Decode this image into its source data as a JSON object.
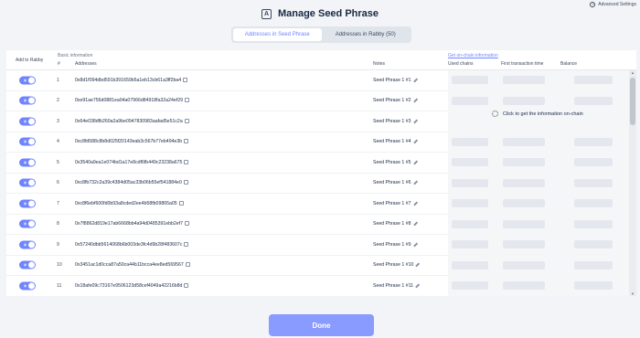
{
  "header": {
    "title": "Manage Seed Phrase",
    "title_icon": "seed-phrase-icon",
    "advanced_settings": "Advanced Settings"
  },
  "tabs": [
    {
      "label": "Addresses in Seed Phrase",
      "active": true
    },
    {
      "label": "Addresses in Rabby (50)",
      "active": false
    }
  ],
  "table": {
    "group_basic": "Basic information",
    "group_onchain": "Get on-chain information",
    "columns": {
      "add_to_rabby": "Add to Rabby",
      "index": "#",
      "addresses": "Addresses",
      "notes": "Notes",
      "used_chains": "Used chains",
      "first_tx": "First transaction time",
      "balance": "Balance"
    },
    "onchain_prompt": "Click to get the information on-chain",
    "rows": [
      {
        "index": "1",
        "address": "0x8d1f094dbd591b391659b5a1eb13cb61a3ff2ba4",
        "note": "Seed Phrase 1 #1",
        "enabled": true
      },
      {
        "index": "2",
        "address": "0xe91ae756d0881ea04a07966d84918fa32a24ef29",
        "note": "Seed Phrase 1 #2",
        "enabled": true
      },
      {
        "index": "3",
        "address": "0x64e038dfb260a2a9be0947830983aafad5e51c2a",
        "note": "Seed Phrase 1 #3",
        "enabled": true
      },
      {
        "index": "4",
        "address": "0xc8fd588c8b8d025f20143eab3c567b77eb494e3b",
        "note": "Seed Phrase 1 #4",
        "enabled": true
      },
      {
        "index": "5",
        "address": "0x3540a9ea1e074bd1a17e8cdf6fb449c23238a675",
        "note": "Seed Phrase 1 #5",
        "enabled": true
      },
      {
        "index": "6",
        "address": "0xc8fb732c2a39c4384d05ac33b06b55ef541884e0",
        "note": "Seed Phrase 1 #6",
        "enabled": true
      },
      {
        "index": "7",
        "address": "0xc8f6ebf600fd0b93a8cded2ee4b58fb09865a05",
        "note": "Seed Phrase 1 #7",
        "enabled": true
      },
      {
        "index": "8",
        "address": "0x7f8862d819e17ab6668bb4a94d0485391ebb2ef7",
        "note": "Seed Phrase 1 #8",
        "enabled": true
      },
      {
        "index": "9",
        "address": "0x57240dbb5614068b6b003de3fc4d9b28f483607c",
        "note": "Seed Phrase 1 #9",
        "enabled": true
      },
      {
        "index": "10",
        "address": "0x3451ac1d0cca87a50ca44b11bcca4ee8ed569567",
        "note": "Seed Phrase 1 #10",
        "enabled": true
      },
      {
        "index": "11",
        "address": "0x18afe09c73167e9506123d58cef4049a42216b8d",
        "note": "Seed Phrase 1 #11",
        "enabled": true
      }
    ]
  },
  "footer": {
    "done_label": "Done"
  },
  "colors": {
    "accent": "#7084ff",
    "button": "#8a9bff",
    "background": "#f2f4f7"
  }
}
